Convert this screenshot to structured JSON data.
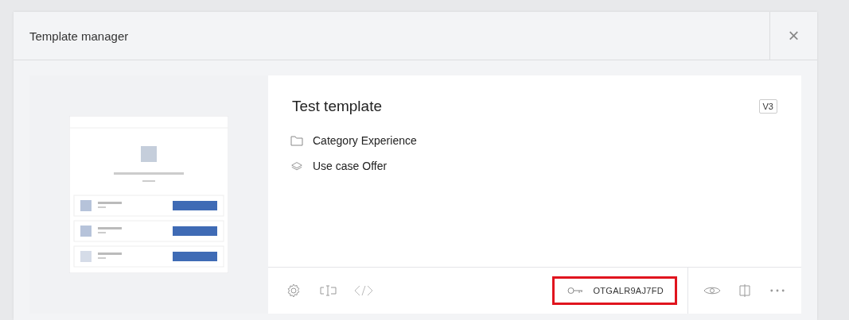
{
  "window": {
    "title": "Template manager",
    "close": "×"
  },
  "template": {
    "name": "Test template",
    "version": "V3",
    "category": "Category Experience",
    "use_case": "Use case Offer"
  },
  "toolbar": {
    "key": "OTGALR9AJ7FD",
    "key_highlighted": true
  }
}
